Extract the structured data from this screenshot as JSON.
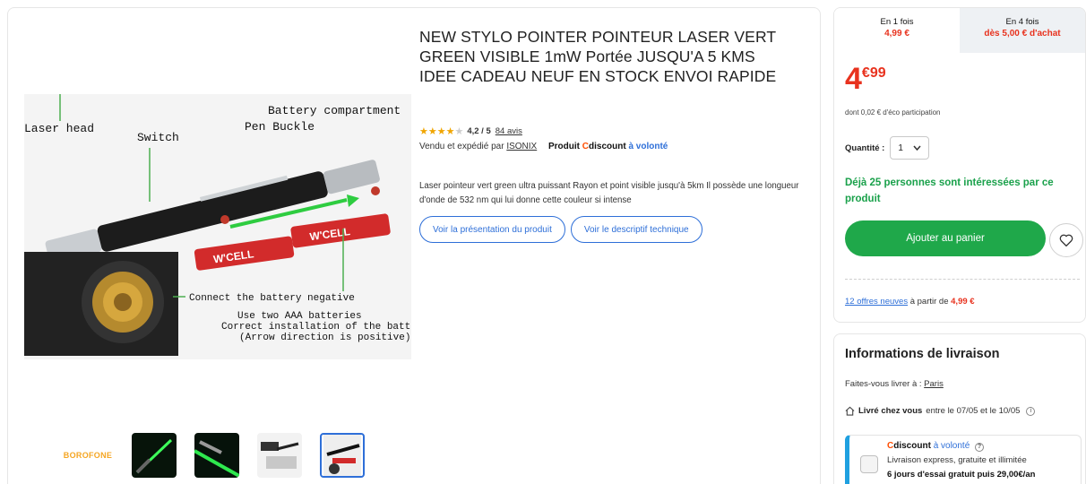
{
  "product": {
    "title": "NEW STYLO POINTER POINTEUR LASER VERT GREEN VISIBLE 1mW Portée JUSQU'A 5 KMS IDEE CADEAU NEUF EN STOCK ENVOI RAPIDE",
    "rating_value": 4.2,
    "rating_text": "4,2 / 5",
    "reviews_link": "84 avis",
    "sold_by_prefix": "Vendu et expédié par",
    "seller_name": "ISONIX",
    "produit_label": "Produit",
    "cdiscount_c": "C",
    "cdiscount_rest": "discount",
    "a_volonte": "à volonté",
    "description": "Laser pointeur vert green ultra puissant Rayon et point visible jusqu'à 5km Il possède une longueur d'onde de 532 nm qui lui donne cette couleur si intense",
    "btn_presentation": "Voir la présentation du produit",
    "btn_technique": "Voir le descriptif technique",
    "image_labels": {
      "battery_compartment": "Battery compartment",
      "pen_buckle": "Pen Buckle",
      "laser_head": "Laser head",
      "switch": "Switch",
      "connect": "Connect the battery negative",
      "use_two": "Use two AAA batteries",
      "correct": "Correct installation of the battery",
      "arrow": "(Arrow direction is positive)"
    },
    "thumb_brand": "BOROFONE"
  },
  "buy_box": {
    "tab1_label": "En 1 fois",
    "tab1_amount": "4,99 €",
    "tab2_label": "En 4 fois",
    "tab2_amount": "dès 5,00 € d'achat",
    "price_int": "4",
    "price_dec": "€99",
    "eco_text": "dont 0,02 € d'éco participation",
    "qty_label": "Quantité :",
    "qty_value": "1",
    "interest_text": "Déjà 25 personnes sont intéressées par ce produit",
    "add_cart": "Ajouter au panier",
    "offers_link": "12 offres neuves",
    "offers_middle": "à partir de",
    "offers_price": "4,99 €"
  },
  "delivery": {
    "title": "Informations de livraison",
    "deliver_to_prefix": "Faites-vous livrer à :",
    "city": "Paris",
    "home_bold": "Livré chez vous",
    "home_rest": "entre le 07/05 et le 10/05",
    "cd_c": "C",
    "cd_rest": "discount",
    "cd_vol": "à volonté",
    "cd_line1": "Livraison express, gratuite et illimitée",
    "cd_line2": "6 jours d'essai gratuit  puis 29,00€/an"
  },
  "colors": {
    "accent_blue": "#2e6fd8",
    "price_red": "#e8321e",
    "green_cta": "#1fa84a",
    "star": "#f0a500"
  }
}
